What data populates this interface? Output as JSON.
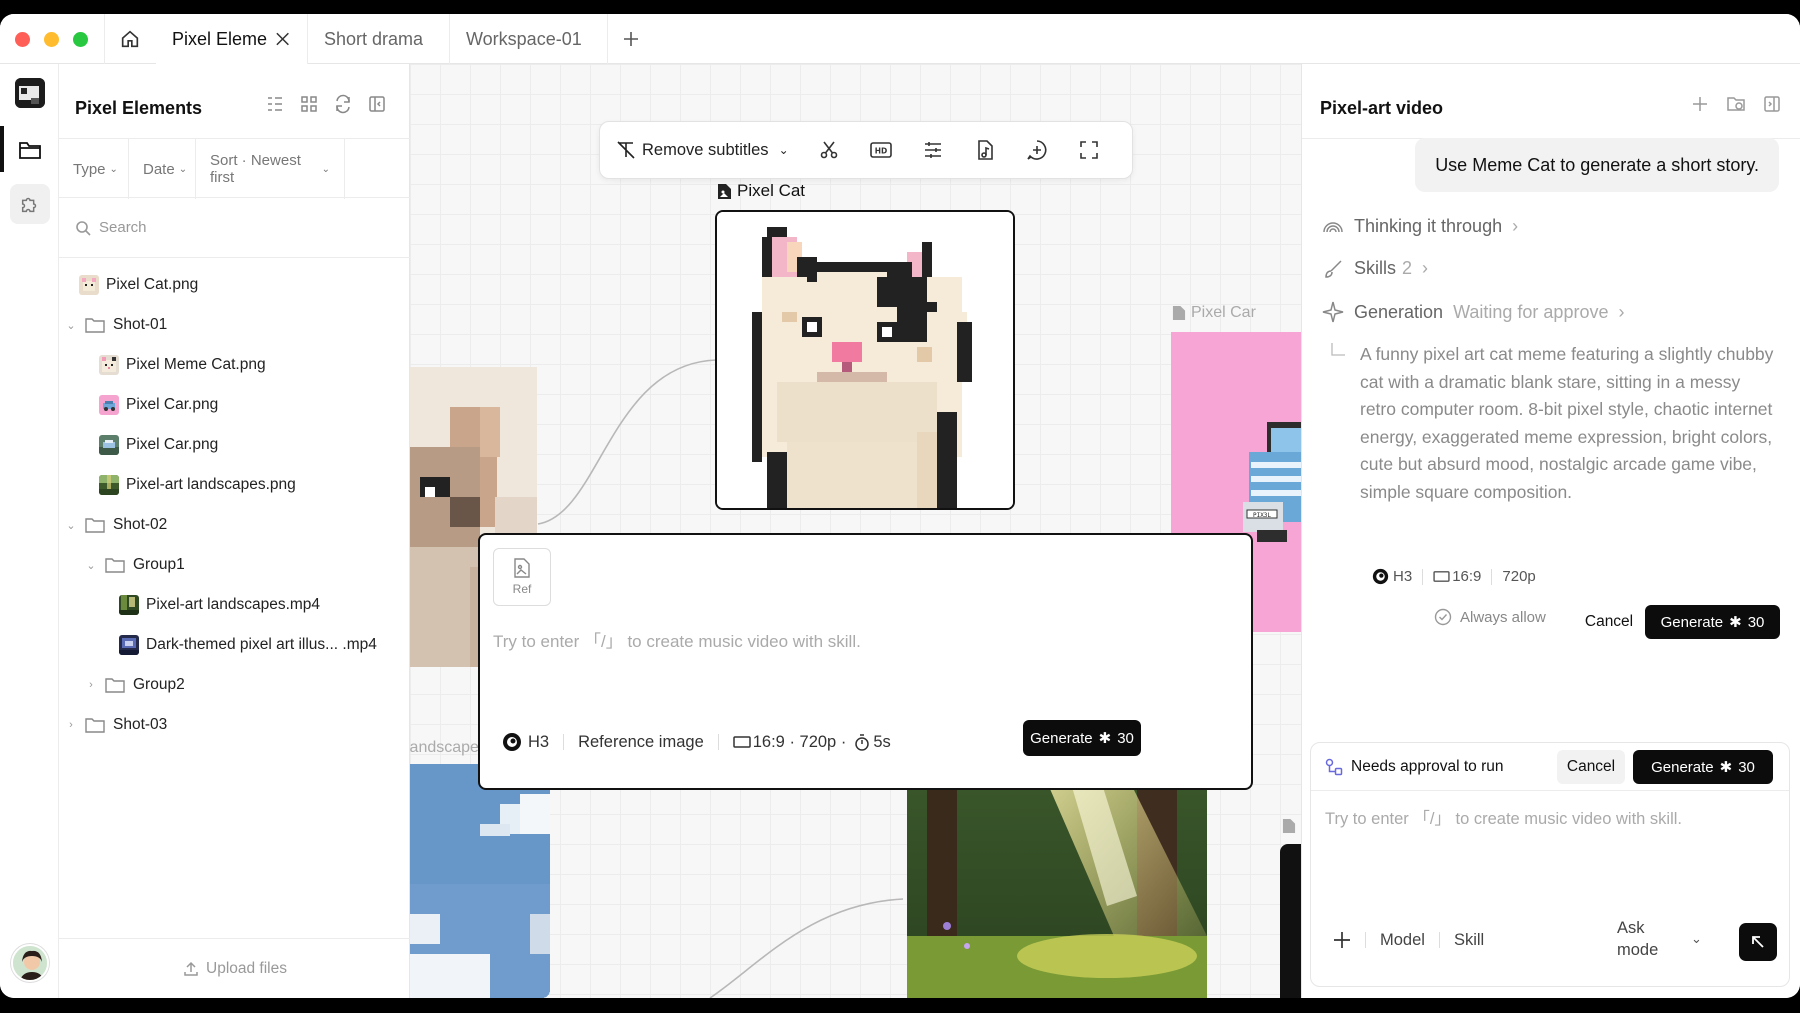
{
  "tabs": {
    "items": [
      {
        "label": "Pixel Eleme"
      },
      {
        "label": "Short drama"
      },
      {
        "label": "Workspace-01"
      }
    ]
  },
  "left_panel": {
    "title": "Pixel Elements",
    "filters": {
      "type": "Type",
      "date": "Date",
      "sort": "Sort · Newest first"
    },
    "search_placeholder": "Search",
    "tree": [
      {
        "label": "Pixel Cat.png"
      },
      {
        "label": "Shot-01"
      },
      {
        "label": "Pixel Meme Cat.png"
      },
      {
        "label": "Pixel Car.png"
      },
      {
        "label": "Pixel Car.png"
      },
      {
        "label": "Pixel-art landscapes.png"
      },
      {
        "label": "Shot-02"
      },
      {
        "label": "Group1"
      },
      {
        "label": "Pixel-art landscapes.mp4"
      },
      {
        "label": "Dark-themed pixel art illus... .mp4"
      },
      {
        "label": "Group2"
      },
      {
        "label": "Shot-03"
      }
    ],
    "upload_label": "Upload files"
  },
  "canvas": {
    "toolbar": {
      "remove_subtitles": "Remove subtitles"
    },
    "pixel_cat_caption": "Pixel Cat",
    "pixel_car_caption": "Pixel Car",
    "landscapes_caption": "landscapes",
    "car_plate": "PIX3L",
    "prompt": {
      "ref_label": "Ref",
      "placeholder": "Try to enter 「/」 to create music video with skill.",
      "model": "H3",
      "reference_image": "Reference image",
      "ratio": "16:9 · 720p ·",
      "duration": "5s",
      "generate": "Generate",
      "credits": "30"
    }
  },
  "right_panel": {
    "title": "Pixel-art video",
    "user_message": "Use Meme Cat to generate a short story.",
    "thinking": "Thinking it through",
    "skills_label": "Skills",
    "skills_count": "2",
    "generation_label": "Generation",
    "generation_status": "Waiting for approve",
    "description": "A funny pixel art cat meme featuring a slightly chubby cat with a dramatic blank stare, sitting in a messy retro computer room. 8-bit pixel style, chaotic internet energy, exaggerated meme expression, bright colors, cute but absurd mood, nostalgic arcade game vibe, simple square composition.",
    "meta": {
      "model": "H3",
      "ratio": "16:9",
      "resolution": "720p"
    },
    "always_allow": "Always allow",
    "cancel": "Cancel",
    "generate": "Generate",
    "credits": "30",
    "approval": {
      "title": "Needs approval to run",
      "cancel": "Cancel",
      "generate": "Generate",
      "credits": "30",
      "placeholder": "Try to enter 「/」 to create music video with skill.",
      "model": "Model",
      "skill": "Skill",
      "mode_line1": "Ask",
      "mode_line2": "mode"
    }
  },
  "colors": {
    "accent_dark": "#0c0c0c",
    "traffic_red": "#ff5f57",
    "traffic_yellow": "#febc2e",
    "traffic_green": "#28c840",
    "car_bg": "#f7a5d4"
  }
}
